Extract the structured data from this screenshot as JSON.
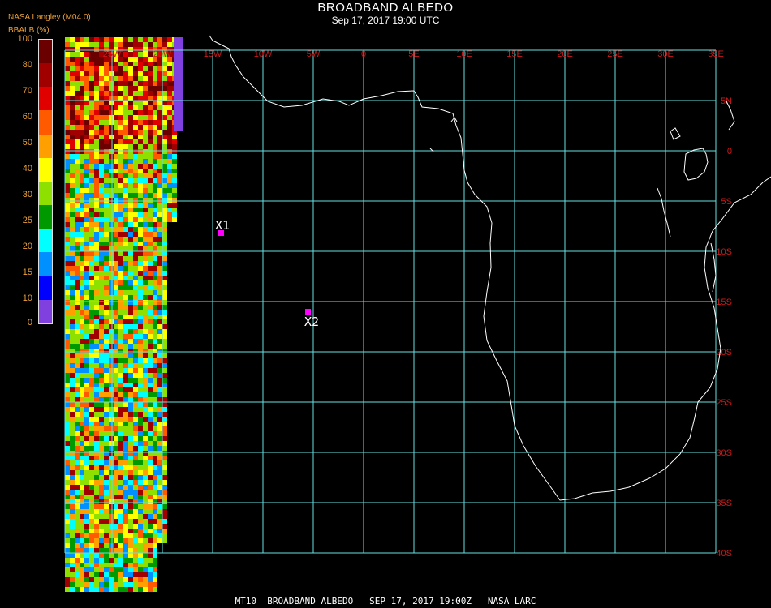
{
  "header": {
    "title": "BROADBAND ALBEDO",
    "subtitle": "Sep 17, 2017 19:00 UTC",
    "source": "NASA Langley (M04.0)",
    "unit_label": "BBALB (%)"
  },
  "colorbar": {
    "labels": [
      "100",
      "80",
      "70",
      "60",
      "50",
      "40",
      "30",
      "25",
      "20",
      "15",
      "10",
      "0"
    ],
    "colors": [
      "#6b0000",
      "#a00000",
      "#e00000",
      "#ff5a00",
      "#ffa000",
      "#ffff00",
      "#8de000",
      "#009900",
      "#00ffff",
      "#0090ff",
      "#0000ff",
      "#8040e0"
    ]
  },
  "map": {
    "grid_color": "#66e0e0",
    "label_color": "#cc1a1a",
    "lon_labels": [
      "25W",
      "20W",
      "15W",
      "10W",
      "5W",
      "0",
      "5E",
      "10E",
      "15E",
      "20E",
      "25E",
      "30E",
      "35E"
    ],
    "lat_labels": [
      "5N",
      "0",
      "5S",
      "10S",
      "15S",
      "20S",
      "25S",
      "30S",
      "35S",
      "40S"
    ],
    "markers": [
      {
        "name": "X1",
        "color": "#ff00ff"
      },
      {
        "name": "X2",
        "color": "#ff00ff"
      }
    ]
  },
  "footer": "MT10  BROADBAND ALBEDO   SEP 17, 2017 19:00Z   NASA LARC"
}
